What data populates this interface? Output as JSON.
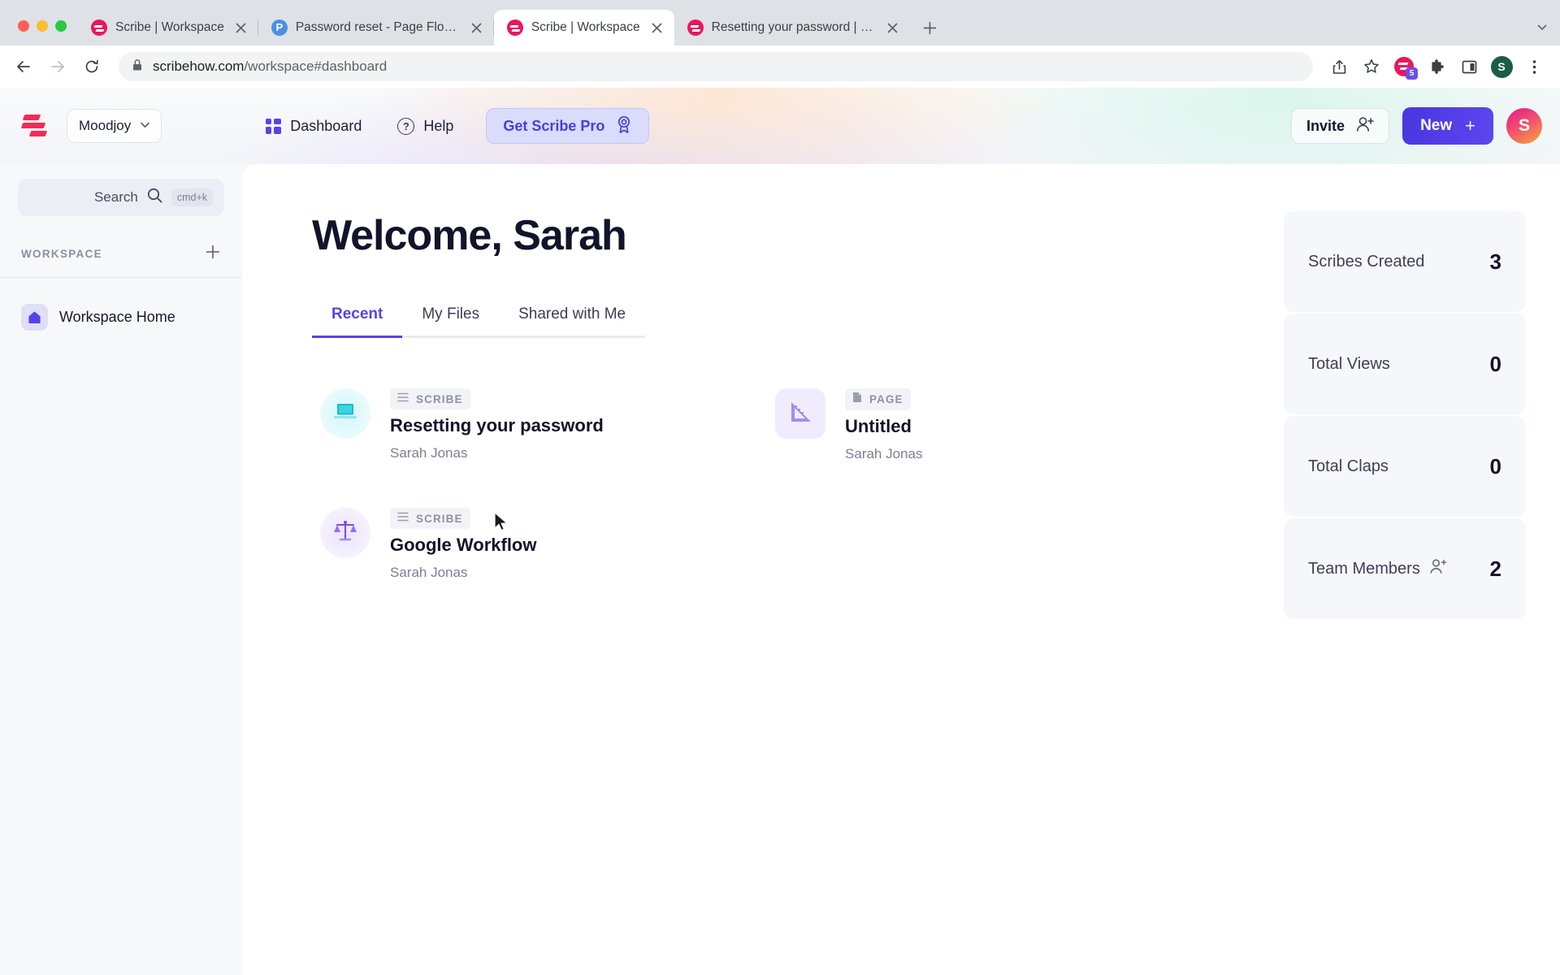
{
  "browser": {
    "tabs": [
      {
        "title": "Scribe | Workspace",
        "favicon": "scribe-icon",
        "active": false
      },
      {
        "title": "Password reset - Page Flows -",
        "favicon": "pageflows-icon",
        "active": false
      },
      {
        "title": "Scribe | Workspace",
        "favicon": "scribe-icon",
        "active": true
      },
      {
        "title": "Resetting your password | Scri",
        "favicon": "scribe-icon",
        "active": false
      }
    ],
    "new_tab_label": "+",
    "tab_list_chevron": "⌄",
    "back_label": "←",
    "forward_label": "→",
    "reload_label": "⟳",
    "url_domain": "scribehow.com",
    "url_path": "/workspace#dashboard",
    "lock_icon": "lock-icon",
    "extension_badge_count": "5",
    "profile_initial": "S",
    "menu_label": "⋮"
  },
  "header": {
    "logo": "scribe-logo",
    "workspace_name": "Moodjoy",
    "workspace_caret": "▼",
    "nav": [
      {
        "label": "Dashboard",
        "icon": "grid-icon"
      },
      {
        "label": "Help",
        "icon": "question-circle-icon"
      }
    ],
    "pro_button": "Get Scribe Pro",
    "pro_icon": "award-ribbon-icon",
    "invite_button": "Invite",
    "invite_icon": "add-person-icon",
    "new_button": "New",
    "new_plus": "+",
    "avatar_initial": "S"
  },
  "sidebar": {
    "search": {
      "label": "Search",
      "shortcut": "cmd+k",
      "icon": "search-icon"
    },
    "section_title": "WORKSPACE",
    "add_label": "+",
    "items": [
      {
        "label": "Workspace Home",
        "icon": "home-icon"
      }
    ]
  },
  "main": {
    "welcome_title": "Welcome, Sarah",
    "tabs": [
      {
        "label": "Recent",
        "active": true
      },
      {
        "label": "My Files",
        "active": false
      },
      {
        "label": "Shared with Me",
        "active": false
      }
    ],
    "cards": [
      {
        "type_label": "SCRIBE",
        "type_icon": "list-lines-icon",
        "title": "Resetting your password",
        "author": "Sarah Jonas",
        "thumb_icon": "laptop-icon",
        "thumb_color": "#16bccd"
      },
      {
        "type_label": "PAGE",
        "type_icon": "document-icon",
        "title": "Untitled",
        "author": "Sarah Jonas",
        "thumb_icon": "triangle-ruler-icon",
        "thumb_color": "#a78bef"
      },
      {
        "type_label": "SCRIBE",
        "type_icon": "list-lines-icon",
        "title": "Google Workflow",
        "author": "Sarah Jonas",
        "thumb_icon": "scales-icon",
        "thumb_color": "#7c4ddb"
      }
    ]
  },
  "stats": [
    {
      "label": "Scribes Created",
      "value": "3",
      "icon": null
    },
    {
      "label": "Total Views",
      "value": "0",
      "icon": null
    },
    {
      "label": "Total Claps",
      "value": "0",
      "icon": null
    },
    {
      "label": "Team Members",
      "value": "2",
      "icon": "add-person-icon"
    }
  ],
  "colors": {
    "accent": "#5444e8",
    "new_button": "#4a36e0",
    "brand_logo": "#ef2d56",
    "pro_button_bg": "#d9dcfb"
  }
}
